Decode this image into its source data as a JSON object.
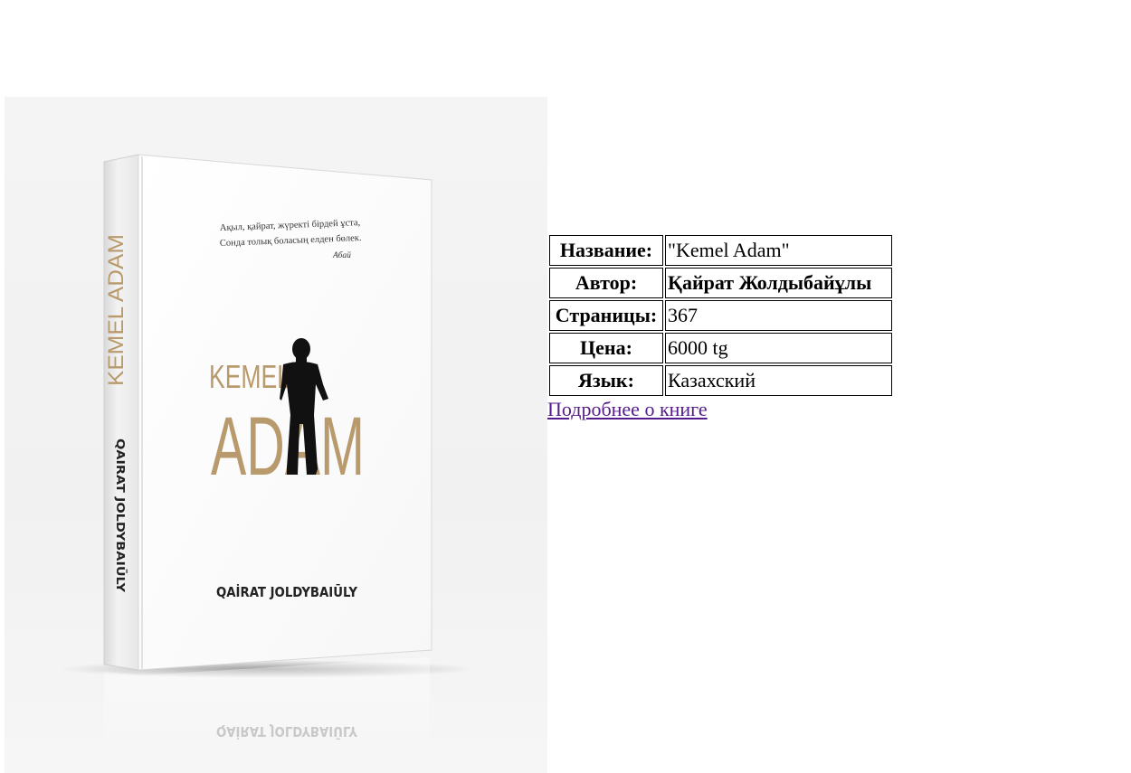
{
  "cover": {
    "quote_line1": "Ақыл, қайрат, жүректі бірдей ұста,",
    "quote_line2": "Сонда толық боласың елден бөлек.",
    "quote_author": "Абай",
    "title_word1": "KEMEL",
    "title_word2": "ADAM",
    "spine_title": "KEMEL ADAM",
    "spine_author": "QAIRAT JOLDYBAIŪLY",
    "front_author": "QAİRAT JOLDYBAIŪLY",
    "reflection_text": "QAİRAT JOLDYBAIŪLY",
    "accent_color": "#b89a6c"
  },
  "book": {
    "rows": [
      {
        "label": "Название:",
        "value": "\"Kemel Adam\"",
        "bold": false
      },
      {
        "label": "Автор:",
        "value": "Қайрат Жолдыбайұлы",
        "bold": true
      },
      {
        "label": "Страницы:",
        "value": "367",
        "bold": false
      },
      {
        "label": "Цена:",
        "value": "6000 tg",
        "bold": false
      },
      {
        "label": "Язык:",
        "value": "Казахский",
        "bold": false
      }
    ],
    "more_link": "Подробнее о книге"
  }
}
